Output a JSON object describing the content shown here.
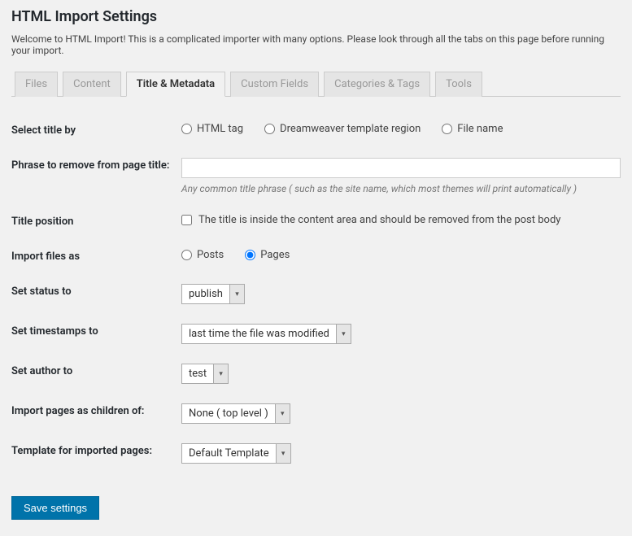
{
  "page_title": "HTML Import Settings",
  "intro": "Welcome to HTML Import! This is a complicated importer with many options. Please look through all the tabs on this page before running your import.",
  "tabs": {
    "files": "Files",
    "content": "Content",
    "title_metadata": "Title & Metadata",
    "custom_fields": "Custom Fields",
    "categories_tags": "Categories & Tags",
    "tools": "Tools"
  },
  "labels": {
    "select_title_by": "Select title by",
    "phrase_remove": "Phrase to remove from page title:",
    "title_position": "Title position",
    "import_files_as": "Import files as",
    "set_status": "Set status to",
    "set_timestamps": "Set timestamps to",
    "set_author": "Set author to",
    "import_children": "Import pages as children of:",
    "template_pages": "Template for imported pages:"
  },
  "select_title_options": {
    "html_tag": "HTML tag",
    "dreamweaver": "Dreamweaver template region",
    "file_name": "File name"
  },
  "phrase_remove": {
    "value": "",
    "description": "Any common title phrase ( such as the site name, which most themes will print automatically )"
  },
  "title_position_checkbox": "The title is inside the content area and should be removed from the post body",
  "import_as_options": {
    "posts": "Posts",
    "pages": "Pages"
  },
  "status_select": "publish",
  "timestamps_select": "last time the file was modified",
  "author_select": "test",
  "children_select": "None ( top level )",
  "template_select": "Default Template",
  "save_button": "Save settings"
}
